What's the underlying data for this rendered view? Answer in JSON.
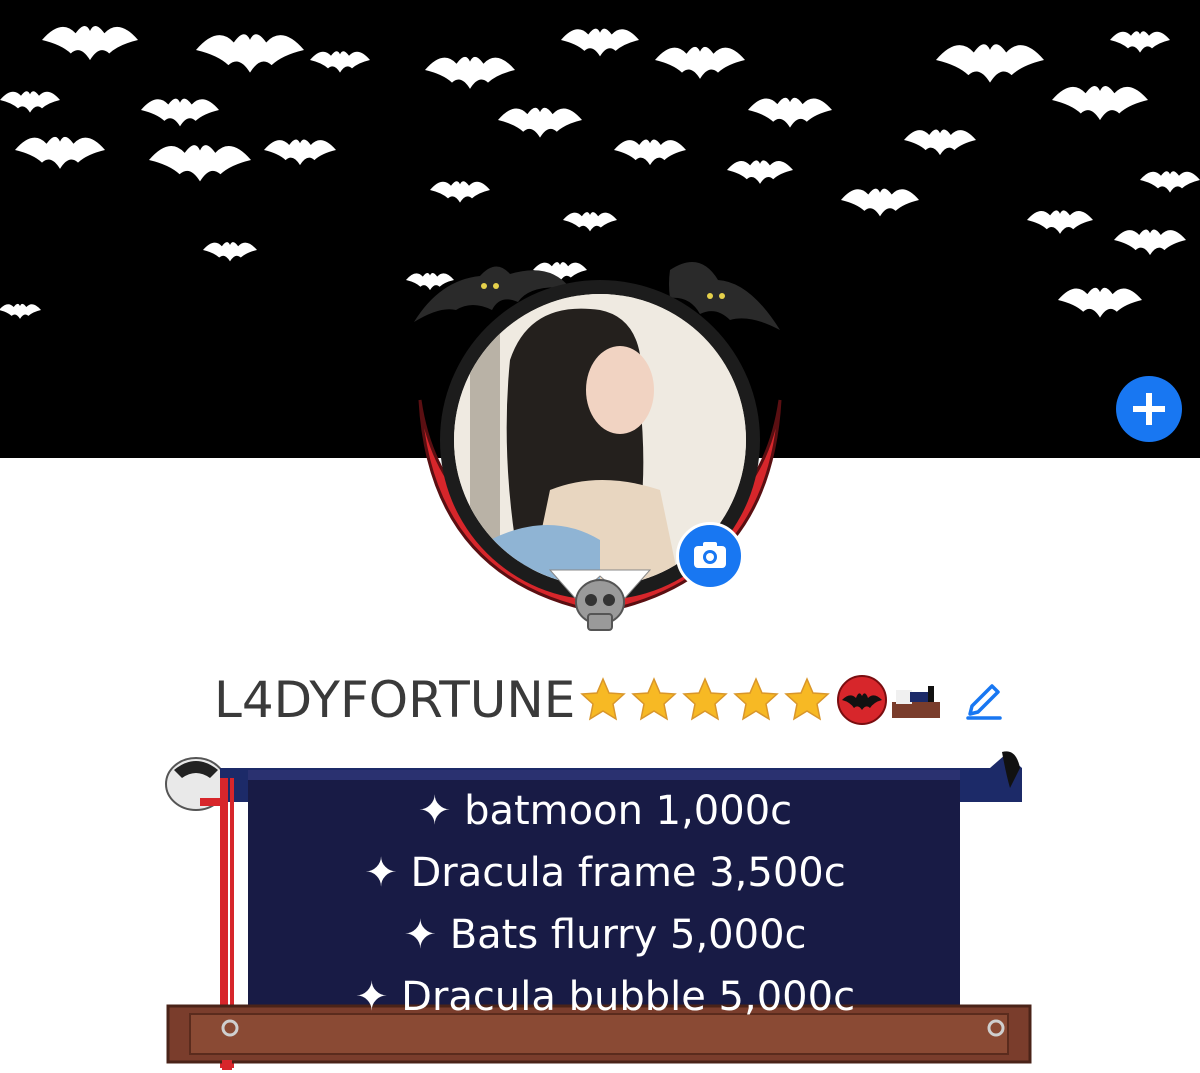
{
  "profile": {
    "username": "L4DYFORTUNE",
    "star_rating": 5,
    "badges": [
      "batmoon-badge-icon",
      "coffin-badge-icon"
    ]
  },
  "cover": {
    "theme": "Bats flurry",
    "add_button_icon": "plus-icon"
  },
  "avatar": {
    "frame": "Dracula frame",
    "camera_button_icon": "camera-icon",
    "skull_icon": "skull-icon"
  },
  "banner": {
    "lines": [
      "✦ batmoon 1,000c",
      "✦ Dracula frame 3,500c",
      "✦ Bats flurry 5,000c",
      "✦ Dracula bubble 5,000c"
    ]
  },
  "colors": {
    "accent": "#1877f2",
    "cover_bg": "#000000",
    "banner_bg": "#181b45",
    "frame_red": "#d7262b",
    "star": "#f7b924",
    "wood": "#7a3d2c"
  }
}
